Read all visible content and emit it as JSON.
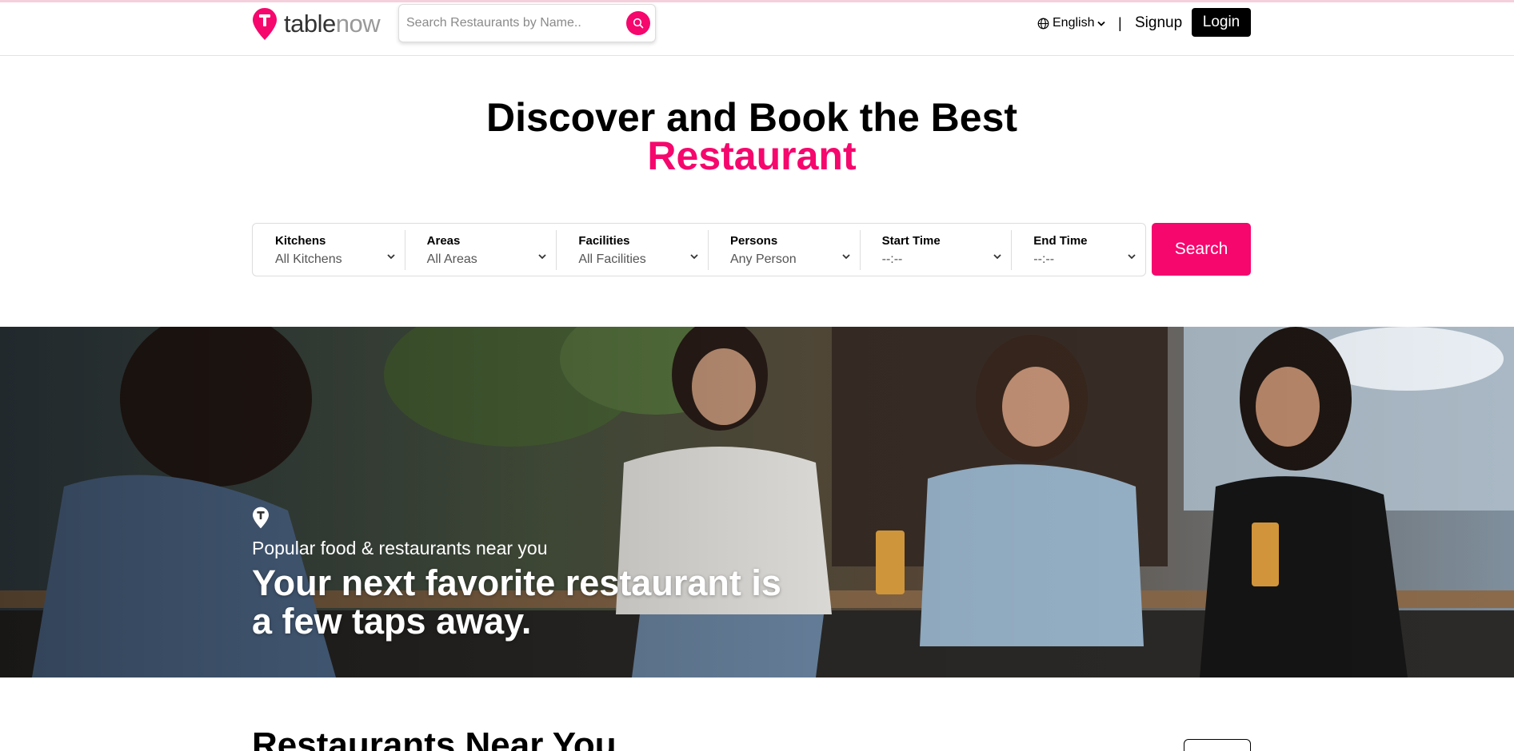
{
  "header": {
    "logo_text_1": "table",
    "logo_text_2": "now",
    "search_placeholder": "Search Restaurants by Name..",
    "language": "English",
    "separator": "|",
    "signup_label": "Signup",
    "login_label": "Login"
  },
  "hero": {
    "title_line1": "Discover and Book the Best",
    "title_line2": "Restaurant"
  },
  "filters": [
    {
      "label": "Kitchens",
      "value": "All Kitchens"
    },
    {
      "label": "Areas",
      "value": "All Areas"
    },
    {
      "label": "Facilities",
      "value": "All Facilities"
    },
    {
      "label": "Persons",
      "value": "Any Person"
    },
    {
      "label": "Start Time",
      "value": "--:--"
    },
    {
      "label": "End Time",
      "value": "--:--"
    }
  ],
  "search_button_label": "Search",
  "banner": {
    "subtitle": "Popular food & restaurants near you",
    "headline_line1": "Your next favorite restaurant is",
    "headline_line2": "a few taps away."
  },
  "section": {
    "title": "Restaurants Near You"
  },
  "colors": {
    "accent": "#f5076d",
    "dark": "#000000",
    "muted_text": "#555555"
  },
  "icons": [
    "tablenow-logo-icon",
    "search-icon",
    "globe-icon",
    "chevron-down-icon",
    "pin-icon"
  ]
}
